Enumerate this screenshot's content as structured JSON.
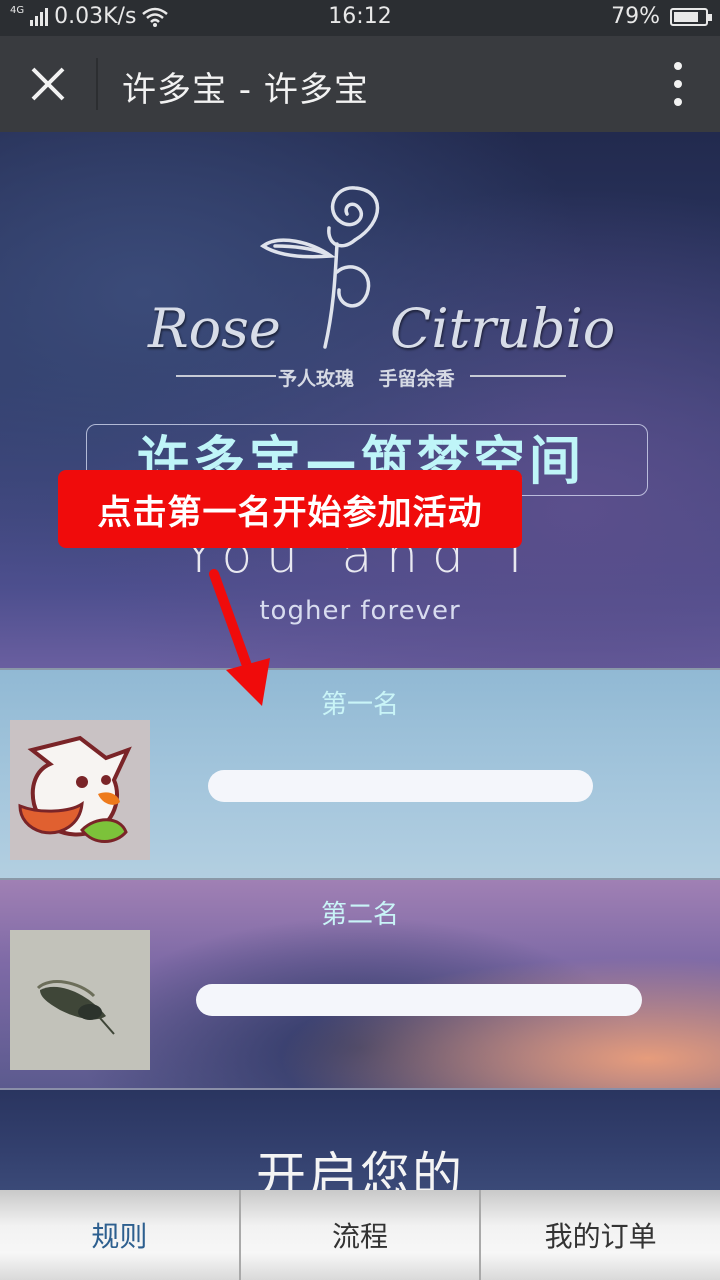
{
  "status_bar": {
    "network": "4G",
    "speed": "0.03K/s",
    "time": "16:12",
    "battery_percent": "79%",
    "battery_level": 0.79
  },
  "title_bar": {
    "title": "许多宝 - 许多宝"
  },
  "hero": {
    "brand_left": "Rose",
    "brand_right": "Citrubio",
    "tagline": "予人玫瑰 手留余香",
    "title_box": "许多宝—筑梦空间",
    "you_and_i": "You and I",
    "forever": "togher forever"
  },
  "callout": {
    "text": "点击第一名开始参加活动"
  },
  "rankings": [
    {
      "label": "第一名"
    },
    {
      "label": "第二名"
    }
  ],
  "teaser": {
    "text": "开启您的"
  },
  "bottom_nav": {
    "items": [
      "规则",
      "流程",
      "我的订单"
    ]
  },
  "colors": {
    "callout_bg": "#f00b0b",
    "rank_label": "#c9f4f7",
    "title_box_text": "#bff5f8",
    "active_nav": "#2d5f8f"
  }
}
